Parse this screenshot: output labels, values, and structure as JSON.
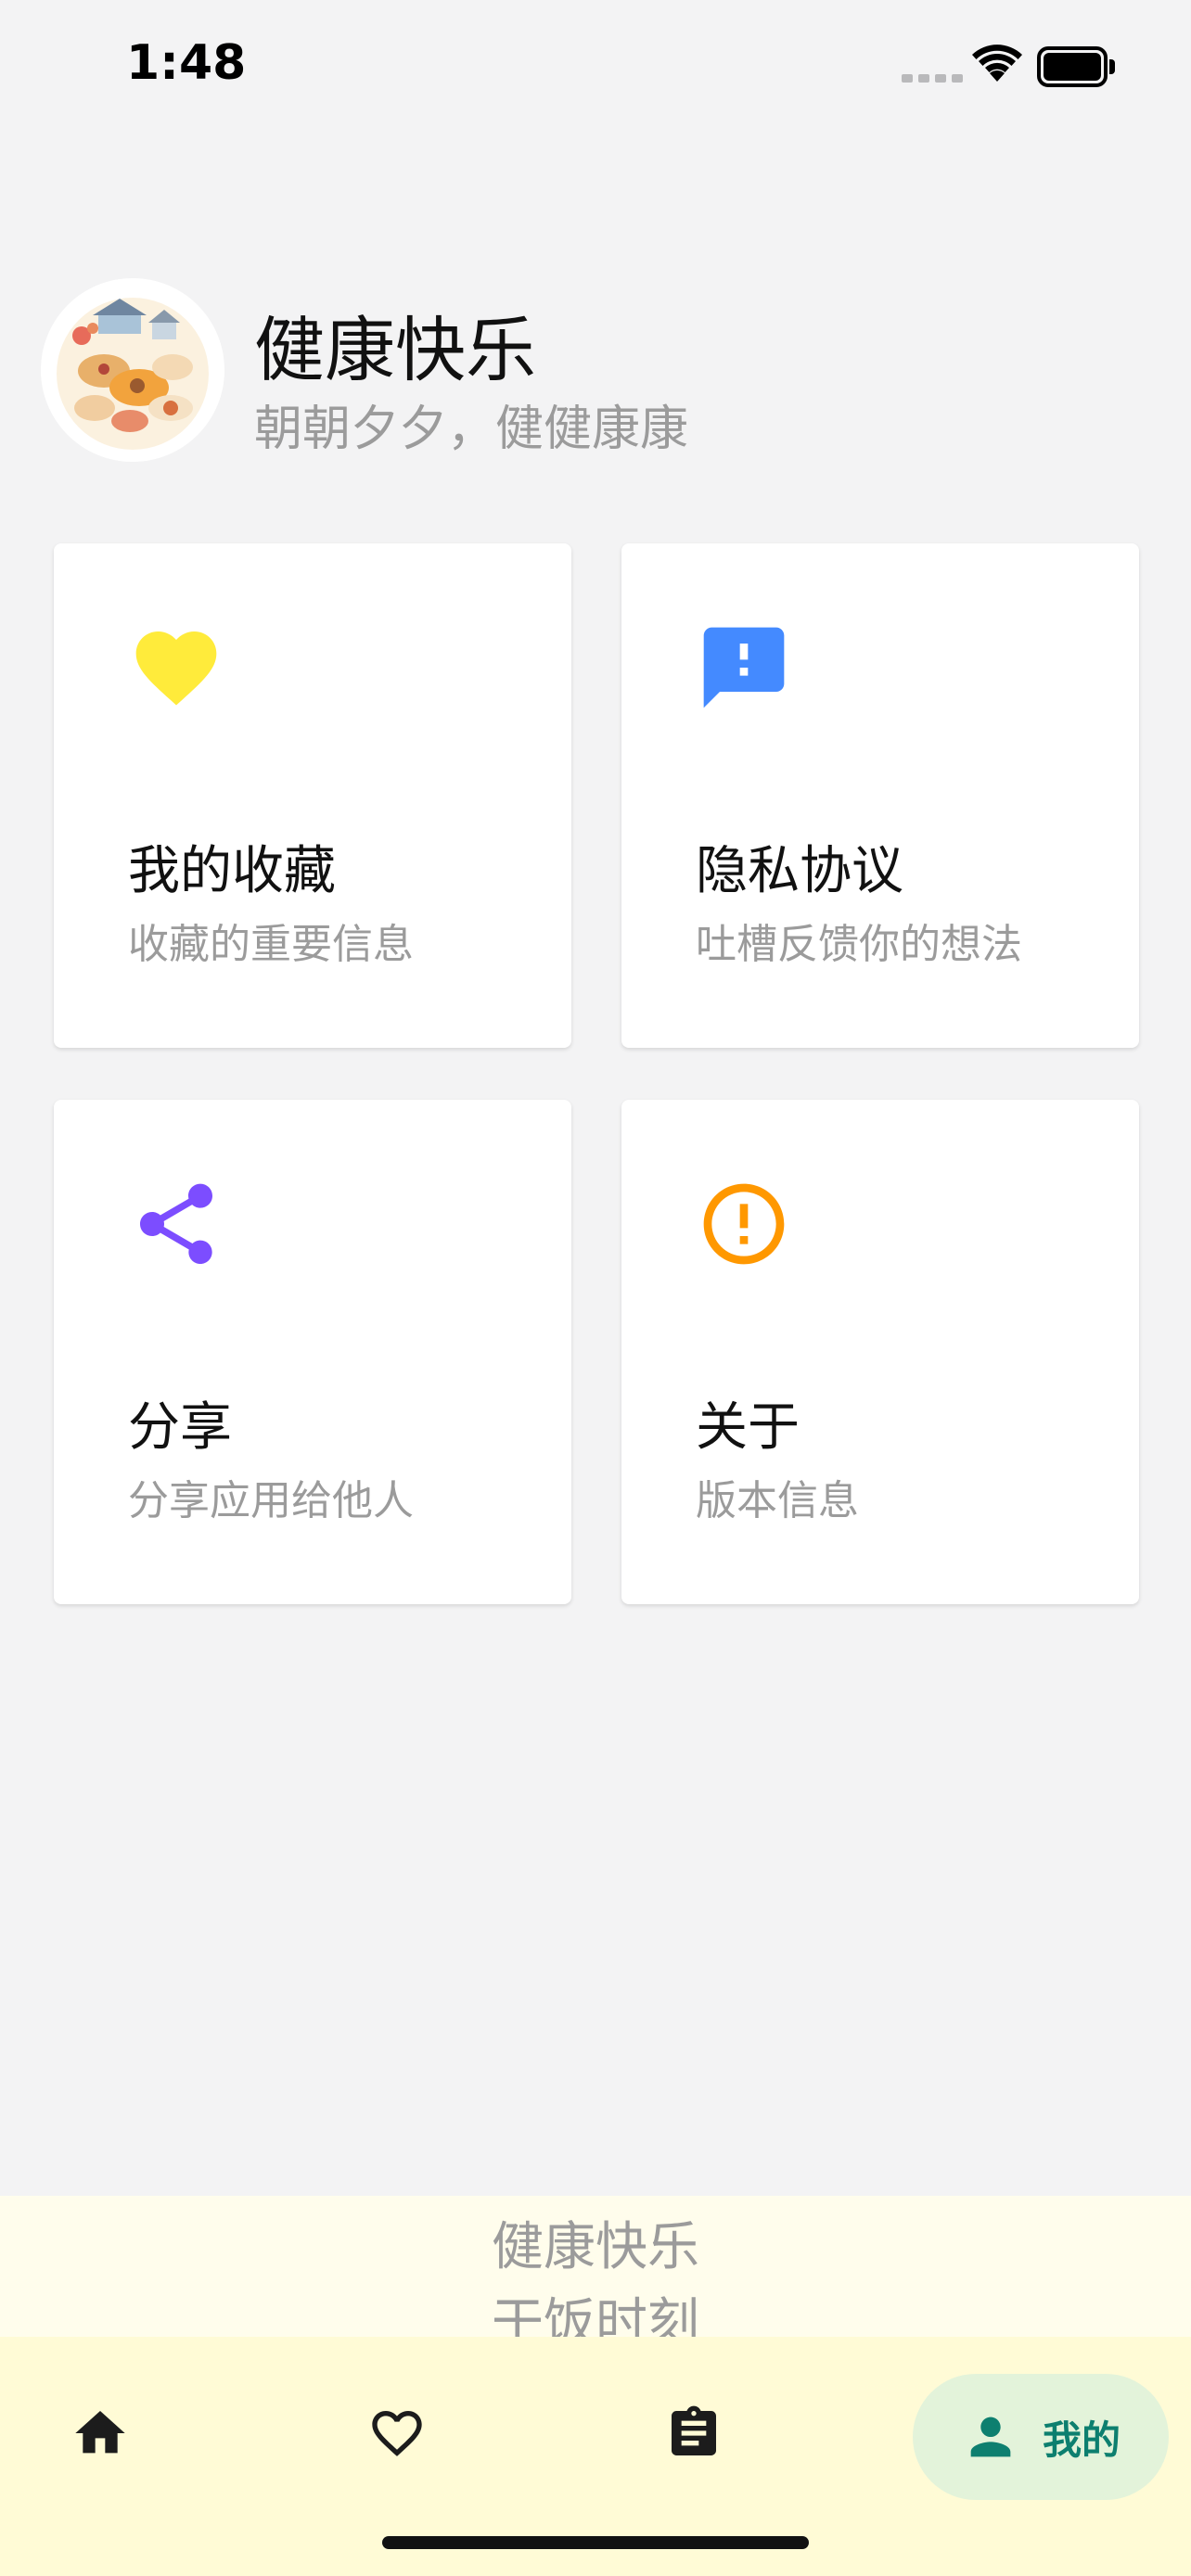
{
  "status_bar": {
    "time": "1:48"
  },
  "profile": {
    "name": "健康快乐",
    "motto": "朝朝夕夕，健健康康"
  },
  "cards": [
    {
      "title": "我的收藏",
      "subtitle": "收藏的重要信息",
      "icon": "heart-icon",
      "color": "#ffeb3b"
    },
    {
      "title": "隐私协议",
      "subtitle": "吐槽反馈你的想法",
      "icon": "feedback-icon",
      "color": "#448aff"
    },
    {
      "title": "分享",
      "subtitle": "分享应用给他人",
      "icon": "share-icon",
      "color": "#7c4dff"
    },
    {
      "title": "关于",
      "subtitle": "版本信息",
      "icon": "info-icon",
      "color": "#ff9800"
    }
  ],
  "slogan": {
    "line1": "健康快乐",
    "line2": "干饭时刻"
  },
  "bottom_nav": {
    "items": [
      {
        "icon": "home-icon"
      },
      {
        "icon": "heart-outline-icon"
      },
      {
        "icon": "clipboard-icon"
      },
      {
        "icon": "person-icon",
        "label": "我的",
        "active": true
      }
    ],
    "active_color": "#0d7f6f",
    "active_pill_color": "#e3f3da"
  }
}
